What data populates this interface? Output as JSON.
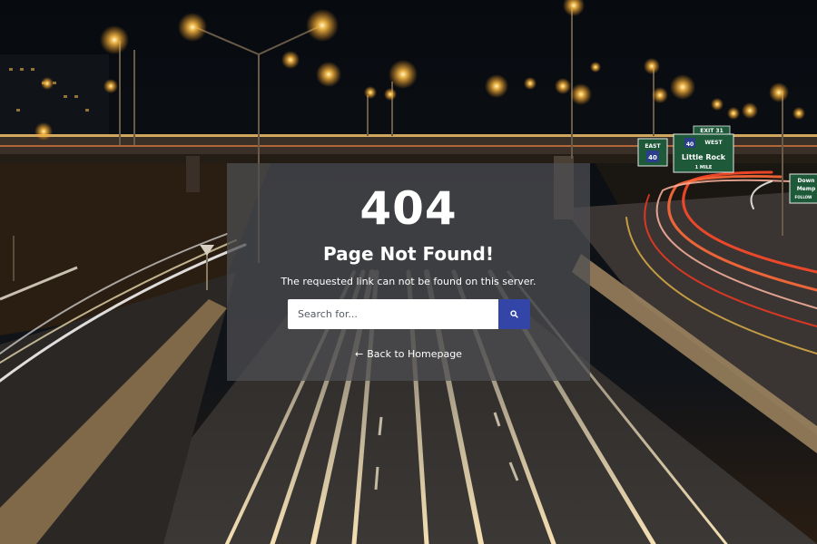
{
  "error": {
    "code": "404",
    "title": "Page Not Found!",
    "message": "The requested link can not be found on this server."
  },
  "search": {
    "placeholder": "Search for...",
    "value": "",
    "button_icon": "search-icon",
    "button_color": "#3346a8"
  },
  "back_link": {
    "icon": "arrow-left-icon",
    "arrow": "←",
    "label": "Back to Homepage"
  },
  "background": {
    "description_icon": "highway-night-photo",
    "signs": {
      "east_route": "EAST",
      "east_number": "40",
      "exit": "EXIT 31",
      "west_route": "WEST",
      "west_number": "40",
      "west_city": "Little Rock",
      "west_distance": "1 MILE",
      "right_sign_line1": "Down",
      "right_sign_line2": "Memp",
      "right_sign_line3": "FOLLOW"
    }
  }
}
